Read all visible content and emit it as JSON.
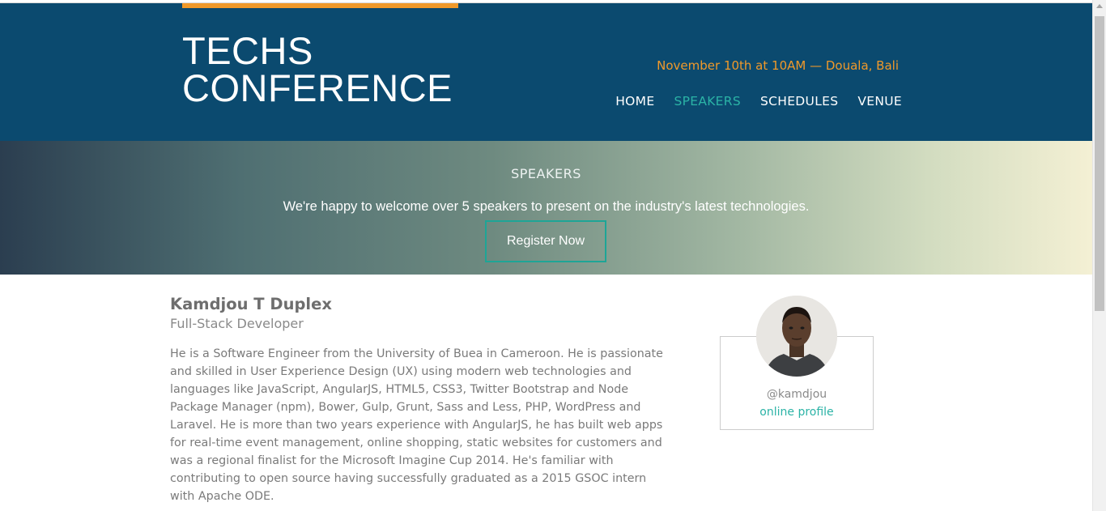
{
  "header": {
    "logo_line1": "TECHS",
    "logo_line2": "CONFERENCE",
    "event_info": "November 10th at 10AM — Douala, Bali",
    "nav": [
      {
        "label": "HOME",
        "active": false
      },
      {
        "label": "SPEAKERS",
        "active": true
      },
      {
        "label": "SCHEDULES",
        "active": false
      },
      {
        "label": "VENUE",
        "active": false
      }
    ]
  },
  "banner": {
    "title": "SPEAKERS",
    "tagline": "We're happy to welcome over 5 speakers to present on the industry's latest technologies.",
    "register_label": "Register Now"
  },
  "speaker": {
    "name": "Kamdjou T Duplex",
    "role": "Full-Stack Developer",
    "bio": "He is a Software Engineer from the University of Buea in Cameroon. He is passionate and skilled in User Experience Design (UX) using modern web technologies and languages like JavaScript, AngularJS, HTML5, CSS3, Twitter Bootstrap and Node Package Manager (npm), Bower, Gulp, Grunt, Sass and Less, PHP, WordPress and Laravel. He is more than two years experience with AngularJS, he has built web apps for real-time event management, online shopping, static websites for customers and was a regional finalist for the Microsoft Imagine Cup 2014. He's familiar with contributing to open source having successfully graduated as a 2015 GSOC intern with Apache ODE.",
    "handle": "@kamdjou",
    "profile_link": "online profile"
  },
  "colors": {
    "header_bg": "#0b4a6f",
    "accent_orange": "#f0992a",
    "accent_teal": "#2bb3a6"
  }
}
